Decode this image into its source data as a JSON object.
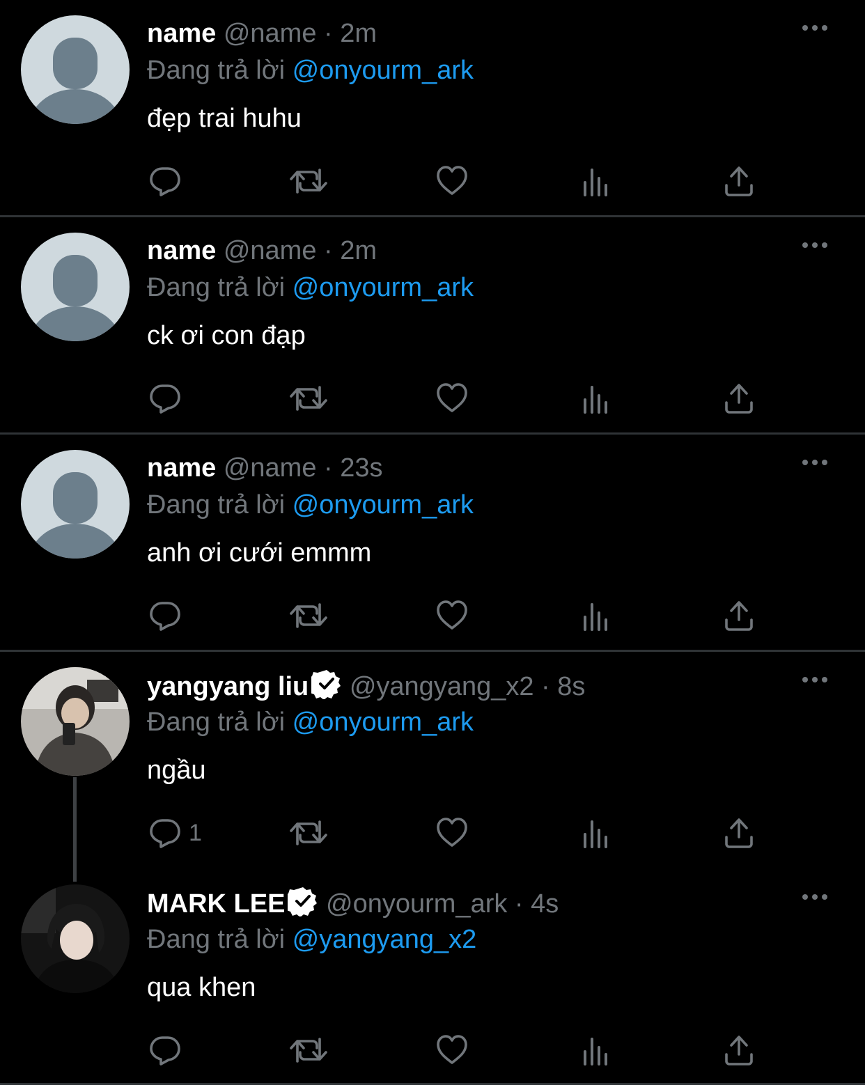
{
  "colors": {
    "background": "#000000",
    "text": "#ffffff",
    "muted": "#71767b",
    "link": "#1d9bf0",
    "divider": "#2f3336",
    "placeholder_avatar_bg": "#cfd9de",
    "placeholder_avatar_fg": "#6c7f8c"
  },
  "icons": {
    "more": "more-horizontal-icon",
    "reply": "reply-icon",
    "retweet": "retweet-icon",
    "like": "heart-icon",
    "views": "views-icon",
    "share": "share-icon",
    "verified": "verified-badge-icon"
  },
  "tweets": [
    {
      "display_name": "name",
      "handle": "@name",
      "time": "2m",
      "reply_prefix": "Đang trả lời",
      "reply_to": "@onyourm_ark",
      "text": "đẹp trai huhu",
      "reply_count": "",
      "verified": false
    },
    {
      "display_name": "name",
      "handle": "@name",
      "time": "2m",
      "reply_prefix": "Đang trả lời",
      "reply_to": "@onyourm_ark",
      "text": "ck ơi con đạp",
      "reply_count": "",
      "verified": false
    },
    {
      "display_name": "name",
      "handle": "@name",
      "time": "23s",
      "reply_prefix": "Đang trả lời",
      "reply_to": "@onyourm_ark",
      "text": "anh ơi cưới emmm",
      "reply_count": "",
      "verified": false
    },
    {
      "display_name": "yangyang liu",
      "handle": "@yangyang_x2",
      "time": "8s",
      "reply_prefix": "Đang trả lời",
      "reply_to": "@onyourm_ark",
      "text": "ngầu",
      "reply_count": "1",
      "verified": true
    },
    {
      "display_name": "MARK LEE",
      "handle": "@onyourm_ark",
      "time": "4s",
      "reply_prefix": "Đang trả lời",
      "reply_to": "@yangyang_x2",
      "text": "qua khen",
      "reply_count": "",
      "verified": true
    }
  ],
  "separator": " · "
}
